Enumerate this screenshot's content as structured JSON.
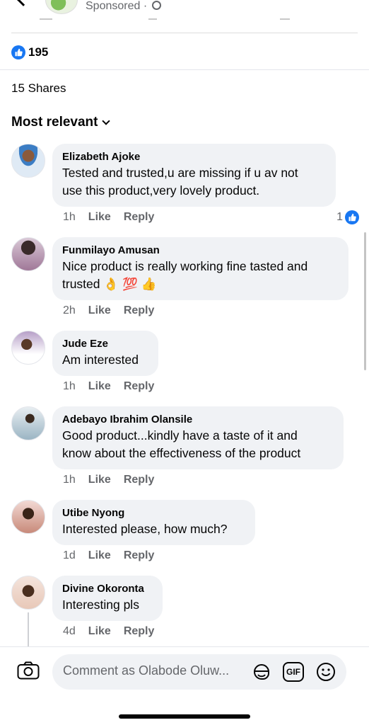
{
  "header": {
    "sponsored_label": "Sponsored ·"
  },
  "reactions": {
    "count": "195"
  },
  "shares_label": "15 Shares",
  "sort_label": "Most relevant",
  "comments": [
    {
      "name": "Elizabeth Ajoke",
      "lines": [
        "Tested and trusted,u are missing if u av not",
        "use this product,very lovely product."
      ],
      "time": "1h",
      "like": "Like",
      "reply": "Reply",
      "reaction_count": "1"
    },
    {
      "name": "Funmilayo Amusan",
      "lines": [
        "Nice product is really working fine tasted and",
        "trusted 👌 💯 👍"
      ],
      "time": "2h",
      "like": "Like",
      "reply": "Reply"
    },
    {
      "name": "Jude Eze",
      "lines": [
        "Am interested"
      ],
      "time": "1h",
      "like": "Like",
      "reply": "Reply"
    },
    {
      "name": "Adebayo Ibrahim Olansile",
      "lines": [
        "Good product...kindly have a taste of it and",
        "know about the effectiveness of the product"
      ],
      "time": "1h",
      "like": "Like",
      "reply": "Reply"
    },
    {
      "name": "Utibe Nyong",
      "lines": [
        "Interested please, how much?"
      ],
      "time": "1d",
      "like": "Like",
      "reply": "Reply"
    },
    {
      "name": "Divine Okoronta",
      "lines": [
        "Interesting pls"
      ],
      "time": "4d",
      "like": "Like",
      "reply": "Reply"
    }
  ],
  "composer": {
    "placeholder": "Comment as Olabode Oluw...",
    "gif_label": "GIF"
  },
  "colors": {
    "accent": "#1877f2",
    "bubble": "#f0f2f5",
    "secondary_text": "#65676b"
  },
  "icons": [
    "back-chevron-icon",
    "globe-icon",
    "like-icon",
    "chevron-down-icon",
    "camera-icon",
    "sticker-icon",
    "gif-icon",
    "emoji-icon"
  ]
}
